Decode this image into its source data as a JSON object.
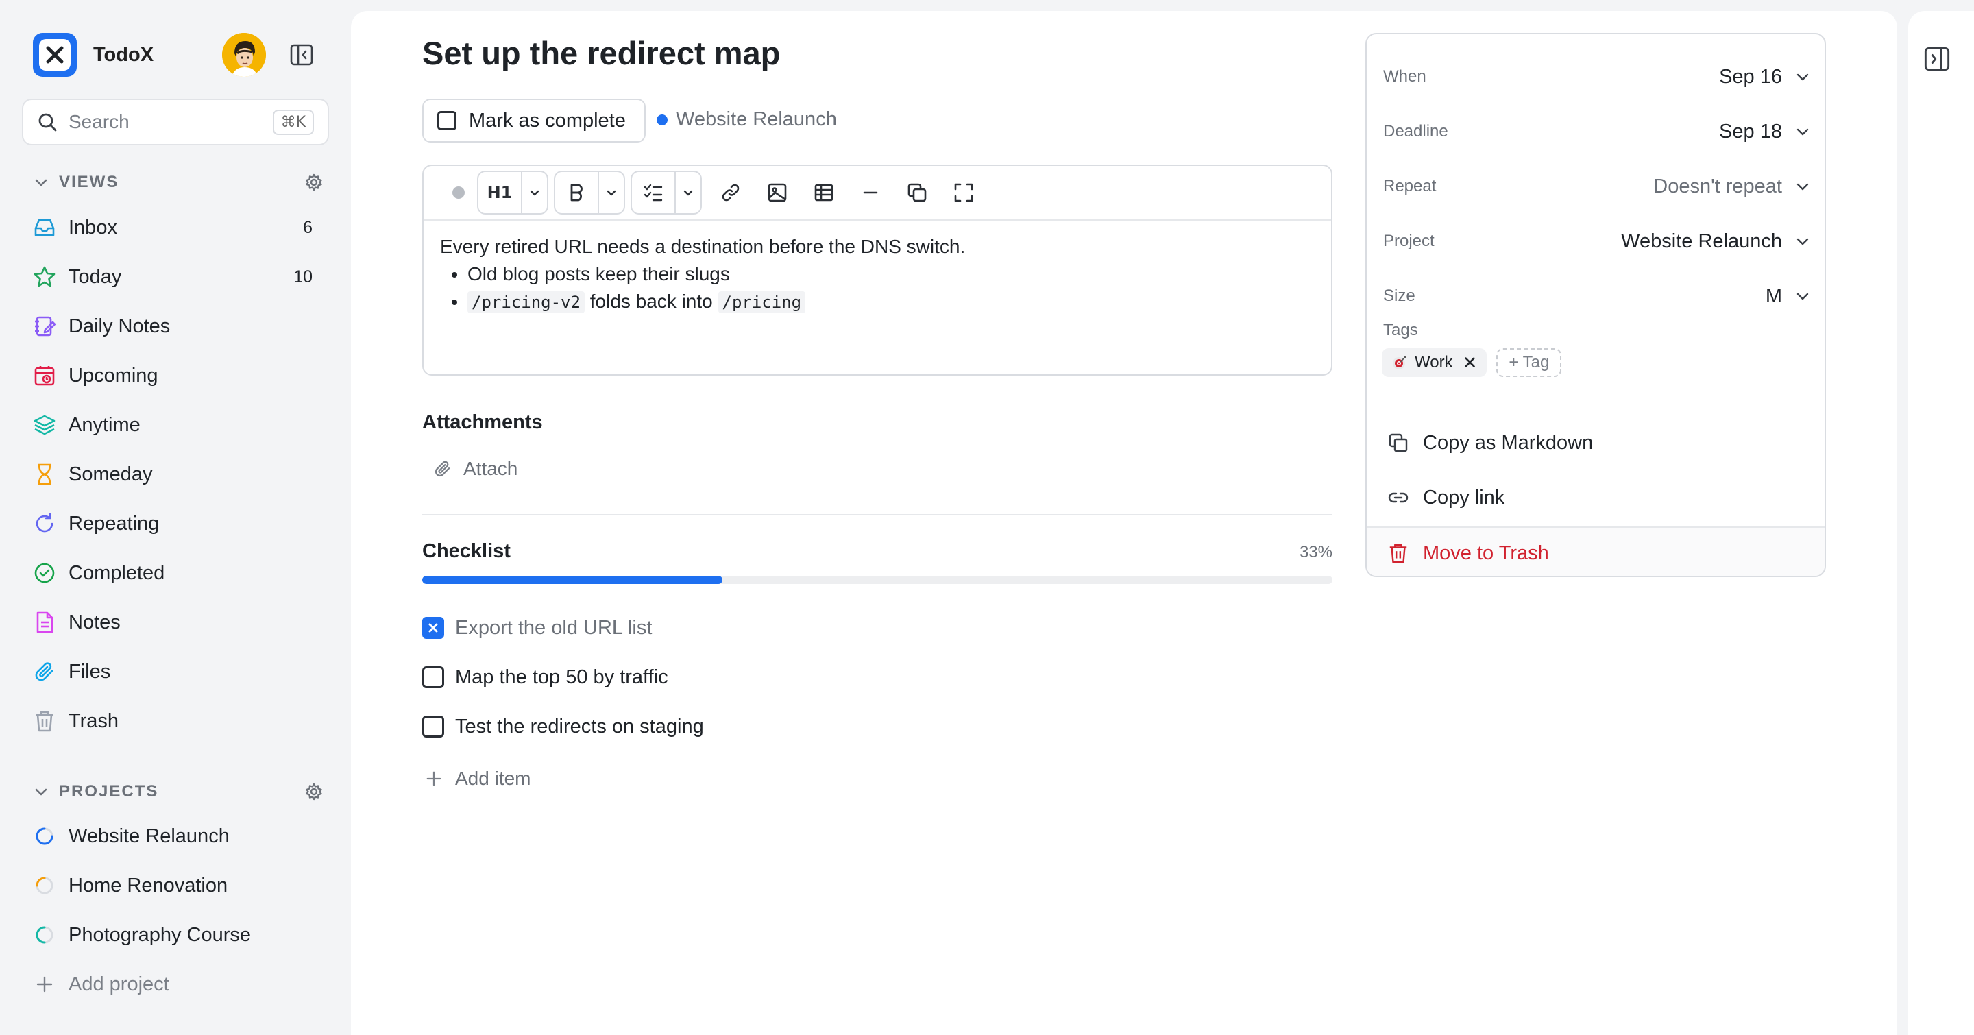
{
  "app": {
    "name": "TodoX"
  },
  "search": {
    "placeholder": "Search",
    "shortcut": "⌘K"
  },
  "views": {
    "title": "VIEWS",
    "items": [
      {
        "label": "Inbox",
        "count": "6",
        "icon": "inbox-icon",
        "color": "#1e9ad6"
      },
      {
        "label": "Today",
        "count": "10",
        "icon": "star-icon",
        "color": "#22a45d"
      },
      {
        "label": "Daily Notes",
        "count": "",
        "icon": "notebook-icon",
        "color": "#8b5cf6"
      },
      {
        "label": "Upcoming",
        "count": "",
        "icon": "calendar-icon",
        "color": "#e11d48"
      },
      {
        "label": "Anytime",
        "count": "",
        "icon": "layers-icon",
        "color": "#14b8a6"
      },
      {
        "label": "Someday",
        "count": "",
        "icon": "hourglass-icon",
        "color": "#f59e0b"
      },
      {
        "label": "Repeating",
        "count": "",
        "icon": "repeat-icon",
        "color": "#6366f1"
      },
      {
        "label": "Completed",
        "count": "",
        "icon": "check-circle-icon",
        "color": "#16a34a"
      },
      {
        "label": "Notes",
        "count": "",
        "icon": "note-icon",
        "color": "#d946ef"
      },
      {
        "label": "Files",
        "count": "",
        "icon": "paperclip-icon",
        "color": "#0ea5e9"
      },
      {
        "label": "Trash",
        "count": "",
        "icon": "trash-icon",
        "color": "#9ca3af"
      }
    ]
  },
  "projects": {
    "title": "PROJECTS",
    "items": [
      {
        "label": "Website Relaunch",
        "color": "#1e6ff0"
      },
      {
        "label": "Home Renovation",
        "color": "#f59e0b"
      },
      {
        "label": "Photography Course",
        "color": "#14b8a6"
      }
    ],
    "add_label": "Add project"
  },
  "task": {
    "title": "Set up the redirect map",
    "mark_complete": "Mark as complete",
    "project": "Website Relaunch",
    "heading_button": "H1",
    "notes": {
      "line1": "Every retired URL needs a destination before the DNS switch.",
      "bullet1": "Old blog posts keep their slugs",
      "bullet2_code1": "/pricing-v2",
      "bullet2_mid": " folds back into ",
      "bullet2_code2": "/pricing"
    },
    "attachments_title": "Attachments",
    "attach_label": "Attach",
    "checklist": {
      "title": "Checklist",
      "percent_label": "33%",
      "progress": 0.33,
      "items": [
        {
          "label": "Export the old URL list",
          "done": true
        },
        {
          "label": "Map the top 50 by traffic",
          "done": false
        },
        {
          "label": "Test the redirects on staging",
          "done": false
        }
      ],
      "add_label": "Add item"
    }
  },
  "panel": {
    "when": {
      "label": "When",
      "value": "Sep 16"
    },
    "deadline": {
      "label": "Deadline",
      "value": "Sep 18"
    },
    "repeat": {
      "label": "Repeat",
      "value": "Doesn't repeat"
    },
    "project": {
      "label": "Project",
      "value": "Website Relaunch"
    },
    "size": {
      "label": "Size",
      "value": "M"
    },
    "tags": {
      "label": "Tags",
      "items": [
        "Work"
      ],
      "add_label": "+ Tag"
    },
    "copy_markdown": "Copy as Markdown",
    "copy_link": "Copy link",
    "move_trash": "Move to Trash"
  },
  "colors": {
    "accent": "#1e6ff0",
    "danger": "#d1222f",
    "sidebar_bg": "#f3f4f6"
  }
}
